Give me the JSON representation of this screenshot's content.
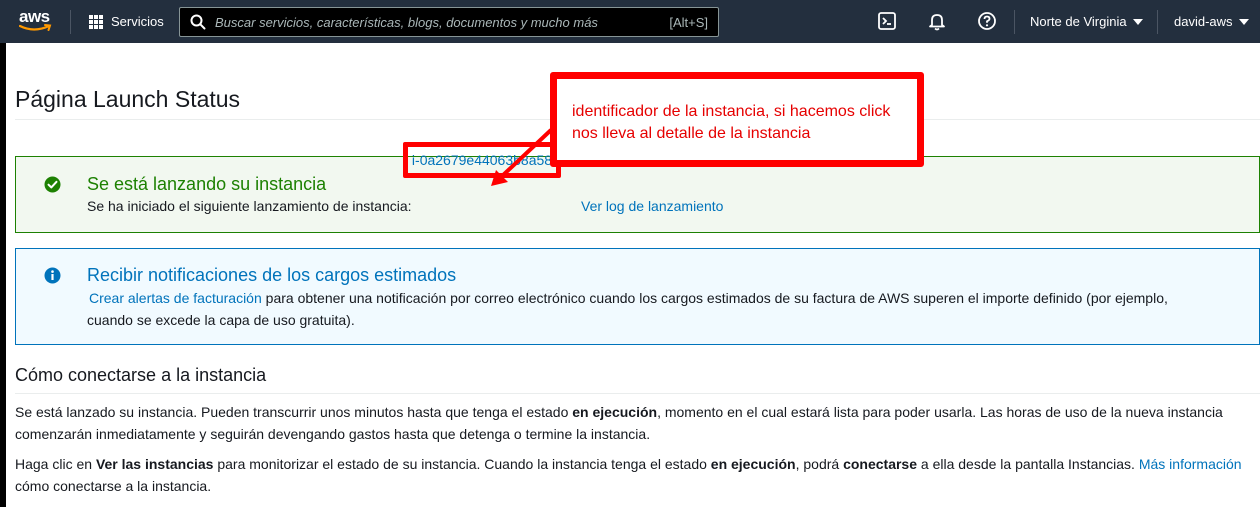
{
  "topnav": {
    "logo_text": "aws",
    "services_label": "Servicios",
    "search_placeholder": "Buscar servicios, características, blogs, documentos y mucho más",
    "search_shortcut": "[Alt+S]",
    "icons": [
      "terminal-icon",
      "bell-icon",
      "help-icon"
    ],
    "region_label": "Norte de Virginia",
    "account_label": "david-aws"
  },
  "page": {
    "title": "Página Launch Status"
  },
  "success_alert": {
    "title": "Se está lanzando su instancia",
    "body_prefix": "Se ha iniciado el siguiente lanzamiento de instancia:",
    "instance_id": "i-0a2679e44063b8a58",
    "log_link": "Ver log de lanzamiento"
  },
  "info_alert": {
    "title": "Recibir notificaciones de los cargos estimados",
    "link": "Crear alertas de facturación",
    "body_rest": "para obtener una notificación por correo electrónico cuando los cargos estimados de su factura de AWS superen el importe definido (por ejemplo, cuando se excede la capa de uso gratuita)."
  },
  "connect_section": {
    "title": "Cómo conectarse a la instancia",
    "p1_a": "Se está lanzado su instancia. Pueden transcurrir unos minutos hasta que tenga el estado ",
    "p1_b": "en ejecución",
    "p1_c": ", momento en el cual estará lista para poder usarla. Las horas de uso de la nueva instancia comenzarán inmediatamente y seguirán devengando gastos hasta que detenga o termine la instancia.",
    "p2_a": "Haga clic en ",
    "p2_b": "Ver las instancias",
    "p2_c": " para monitorizar el estado de su instancia. Cuando la instancia tenga el estado ",
    "p2_d": "en ejecución",
    "p2_e": ", podrá ",
    "p2_f": "conectarse",
    "p2_g": " a ella desde la pantalla Instancias. ",
    "p2_link": "Más información",
    "p2_h": " cómo conectarse a la instancia."
  },
  "annotation": {
    "text": "identificador de la instancia, si hacemos click nos lleva al detalle de la instancia",
    "color": "#ff0000"
  },
  "colors": {
    "nav_bg": "#232f3e",
    "success": "#1d8102",
    "info": "#0073bb",
    "link": "#0073bb"
  }
}
